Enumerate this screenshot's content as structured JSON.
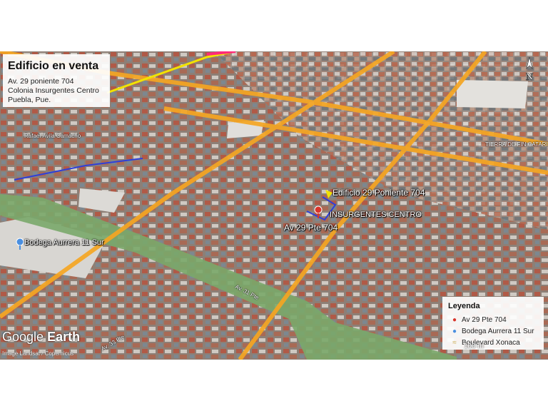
{
  "title_box": {
    "title": "Edificio en venta",
    "line1": "Av. 29 poniente 704",
    "line2": "Colonia Insurgentes Centro",
    "line3": "Puebla, Pue."
  },
  "map_labels": {
    "building": "Edificio 29 Poniente 704",
    "neighborhood": "INSURGENTES CENTRO",
    "address": "Av 29 Pte 704",
    "store": "Bodega Aurrera 11 Sur",
    "road_31": "Av. 31 Pte",
    "road_33": "Av. 33 Pte",
    "area_ne": "TIERRA DE FIN CATARI",
    "road_nw": "Rafael Ávila Camacho"
  },
  "legend": {
    "heading": "Leyenda",
    "items": [
      {
        "label": "Av 29 Pte 704",
        "icon": "red-placemark-icon",
        "color": "#d9342b"
      },
      {
        "label": "Bodega Aurrera 11 Sur",
        "icon": "blue-placemark-icon",
        "color": "#4a8fe0"
      },
      {
        "label": "Boulevard Xonaca",
        "icon": "path-icon",
        "color": "#c9a646"
      }
    ]
  },
  "scale": "100 m",
  "compass": "N",
  "brand": {
    "google": "Google",
    "earth": "Earth"
  },
  "credit": "Image Landsat / Copernicus",
  "colors": {
    "road": "#f5a623",
    "route": "#2f3fd8",
    "pink": "#ff2a7a",
    "yellow": "#f2e200",
    "rail": "#7aa86a"
  }
}
